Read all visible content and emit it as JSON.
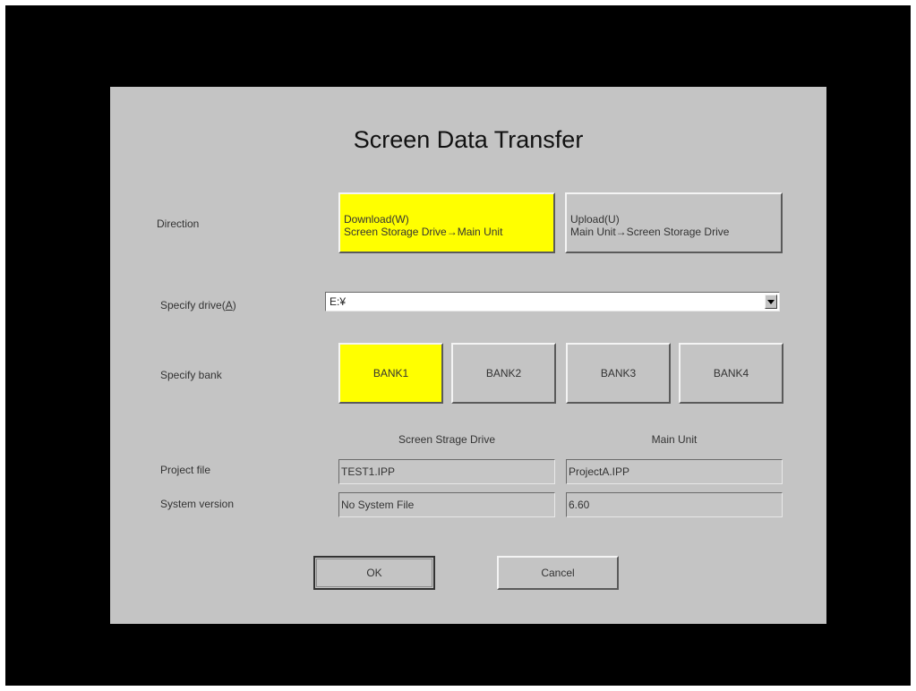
{
  "dialog": {
    "title": "Screen Data Transfer"
  },
  "direction": {
    "label": "Direction",
    "download": {
      "line1": "Download(W)",
      "line2": "Screen Storage Drive→Main Unit",
      "selected": true
    },
    "upload": {
      "line1": "Upload(U)",
      "line2": "Main Unit→Screen Storage Drive",
      "selected": false
    }
  },
  "drive": {
    "label": "Specify drive(A)",
    "value": "E:¥"
  },
  "bank": {
    "label": "Specify bank",
    "buttons": [
      "BANK1",
      "BANK2",
      "BANK3",
      "BANK4"
    ],
    "selected": "BANK1"
  },
  "info": {
    "columns": [
      "Screen Strage Drive",
      "Main Unit"
    ],
    "rows": [
      {
        "label": "Project file",
        "values": [
          "TEST1.IPP",
          "ProjectA.IPP"
        ]
      },
      {
        "label": "System version",
        "values": [
          "No System File",
          "6.60"
        ]
      }
    ]
  },
  "actions": {
    "ok": "OK",
    "cancel": "Cancel"
  },
  "colors": {
    "selected": "#ffff00",
    "dialog_bg": "#c4c4c4",
    "screen_bg": "#000000"
  }
}
